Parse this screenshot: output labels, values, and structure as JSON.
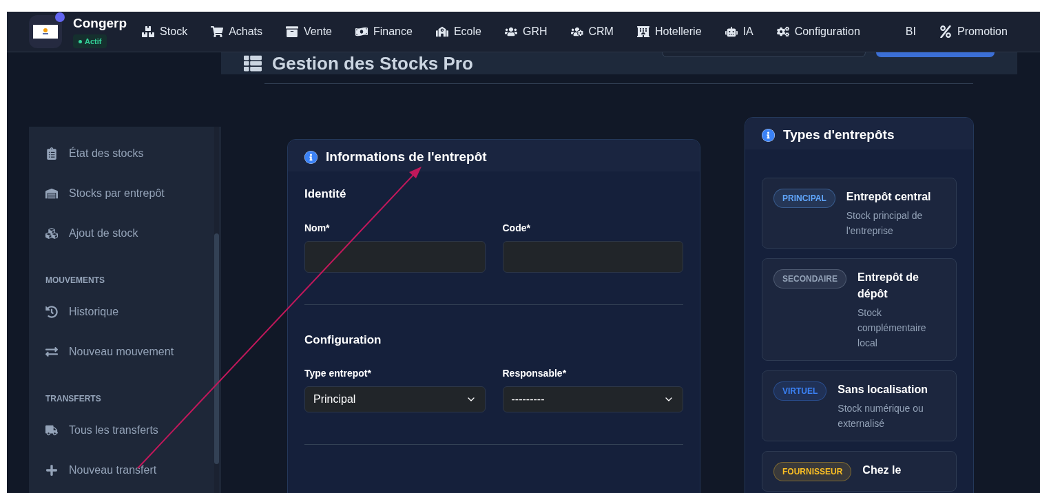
{
  "nav": {
    "brand": "Congerp",
    "status": "Actif",
    "items": [
      {
        "label": "Stock"
      },
      {
        "label": "Achats"
      },
      {
        "label": "Vente"
      },
      {
        "label": "Finance"
      },
      {
        "label": "Ecole"
      },
      {
        "label": "GRH"
      },
      {
        "label": "CRM"
      },
      {
        "label": "Hotellerie"
      },
      {
        "label": "IA"
      },
      {
        "label": "Configuration"
      },
      {
        "label": "BI"
      },
      {
        "label": "Promotion"
      }
    ]
  },
  "page_header": {
    "title": "Gestion des Stocks Pro"
  },
  "sidebar": {
    "sections": [
      {
        "items": [
          {
            "label": "État des stocks"
          },
          {
            "label": "Stocks par entrepôt"
          },
          {
            "label": "Ajout de stock"
          }
        ]
      },
      {
        "heading": "MOUVEMENTS",
        "items": [
          {
            "label": "Historique"
          },
          {
            "label": "Nouveau mouvement"
          }
        ]
      },
      {
        "heading": "TRANSFERTS",
        "items": [
          {
            "label": "Tous les transferts"
          },
          {
            "label": "Nouveau transfert"
          }
        ]
      }
    ]
  },
  "form": {
    "title": "Informations de l'entrepôt",
    "sections": [
      {
        "title": "Identité",
        "fields": [
          {
            "label": "Nom*",
            "kind": "text"
          },
          {
            "label": "Code*",
            "kind": "text"
          }
        ]
      },
      {
        "title": "Configuration",
        "fields": [
          {
            "label": "Type entrepot*",
            "kind": "select",
            "value": "Principal"
          },
          {
            "label": "Responsable*",
            "kind": "select",
            "value": "---------"
          }
        ]
      }
    ]
  },
  "types_panel": {
    "title": "Types d'entrepôts",
    "types": [
      {
        "badge": "PRINCIPAL",
        "color": "#60a5fa",
        "name": "Entrepôt central",
        "description": "Stock principal de l'entreprise"
      },
      {
        "badge": "SECONDAIRE",
        "color": "#94a3b8",
        "name": "Entrepôt de dépôt",
        "description": "Stock complémentaire local"
      },
      {
        "badge": "VIRTUEL",
        "color": "#3b82f6",
        "name": "Sans localisation",
        "description": "Stock numérique ou externalisé"
      },
      {
        "badge": "FOURNISSEUR",
        "color": "#fbbf24",
        "name": "Chez le"
      }
    ]
  }
}
